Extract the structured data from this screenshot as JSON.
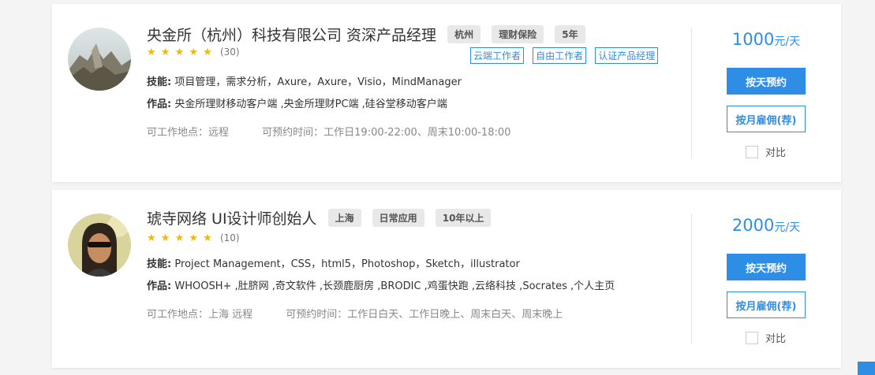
{
  "cards": [
    {
      "name": "央金所（杭州）科技有限公司 资深产品经理",
      "tags": [
        "杭州",
        "理财保险",
        "5年"
      ],
      "stars": "★ ★ ★ ★ ★",
      "rating_count": "(30)",
      "badges": [
        "云端工作者",
        "自由工作者",
        "认证产品经理"
      ],
      "skills_label": "技能:",
      "skills": "项目管理，需求分析，Axure，Axure，Visio，MindManager",
      "works_label": "作品:",
      "works": "央金所理财移动客户端 ,央金所理财PC端 ,硅谷堂移动客户端",
      "location": "可工作地点：远程",
      "availability": "可预约时间：工作日19:00-22:00、周末10:00-18:00",
      "price": "1000",
      "price_unit": "元/天",
      "book_day": "按天预约",
      "book_month": "按月雇佣(荐)",
      "compare": "对比"
    },
    {
      "name": "琥寺网络 UI设计师创始人",
      "tags": [
        "上海",
        "日常应用",
        "10年以上"
      ],
      "stars": "★ ★ ★ ★ ★",
      "rating_count": "(10)",
      "badges": [],
      "skills_label": "技能:",
      "skills": "Project Management，CSS，html5，Photoshop，Sketch，illustrator",
      "works_label": "作品:",
      "works": "WHOOSH+ ,肚脐网 ,奇文软件 ,长颈鹿厨房 ,BRODIC ,鸡蛋快跑 ,云络科技 ,Socrates ,个人主页",
      "location": "可工作地点：上海 远程",
      "availability": "可预约时间：工作日白天、工作日晚上、周末白天、周末晚上",
      "price": "2000",
      "price_unit": "元/天",
      "book_day": "按天预约",
      "book_month": "按月雇佣(荐)",
      "compare": "对比"
    }
  ],
  "colors": {
    "accent": "#2e8ee6",
    "star": "#f5b800"
  }
}
